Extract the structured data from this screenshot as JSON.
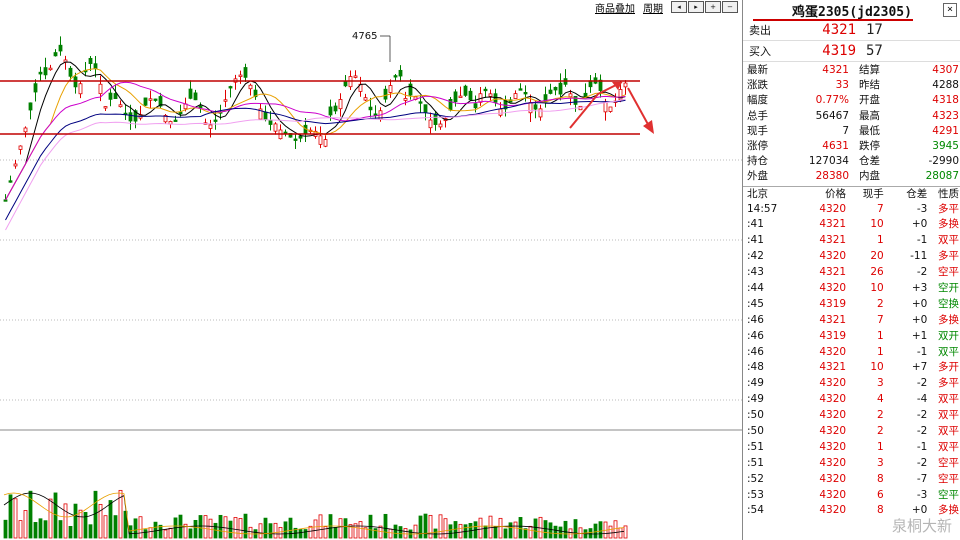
{
  "toolbar": {
    "overlay_label": "商品叠加",
    "period_label": "周期",
    "btn_icons": [
      "left-arrow-icon",
      "right-arrow-icon",
      "zoom-in-icon",
      "zoom-out-icon"
    ]
  },
  "chart_data": {
    "type": "candlestick",
    "high_marker": "4765",
    "colors": {
      "up": "#e00000",
      "down": "#008000",
      "levels": "#c00000",
      "arrow": "#e03030"
    },
    "moving_average_colors": [
      "#000000",
      "#e8a000",
      "#cc00cc",
      "#000080",
      "#b050b0",
      "#f0a0f0"
    ]
  },
  "instrument": {
    "title": "鸡蛋2305(jd2305)"
  },
  "orderbook": {
    "ask": {
      "label": "卖出",
      "price": "4321",
      "volume": "17"
    },
    "bid": {
      "label": "买入",
      "price": "4319",
      "volume": "57"
    }
  },
  "quote": [
    {
      "k1": "最新",
      "v1": "4321",
      "c1": "red",
      "k2": "结算",
      "v2": "4307",
      "c2": "red"
    },
    {
      "k1": "涨跌",
      "v1": "33",
      "c1": "red",
      "k2": "昨结",
      "v2": "4288",
      "c2": "dark"
    },
    {
      "k1": "幅度",
      "v1": "0.77%",
      "c1": "red",
      "k2": "开盘",
      "v2": "4318",
      "c2": "red"
    },
    {
      "k1": "总手",
      "v1": "56467",
      "c1": "dark",
      "k2": "最高",
      "v2": "4323",
      "c2": "red"
    },
    {
      "k1": "现手",
      "v1": "7",
      "c1": "dark",
      "k2": "最低",
      "v2": "4291",
      "c2": "red"
    },
    {
      "k1": "涨停",
      "v1": "4631",
      "c1": "red",
      "k2": "跌停",
      "v2": "3945",
      "c2": "green"
    },
    {
      "k1": "持仓",
      "v1": "127034",
      "c1": "dark",
      "k2": "仓差",
      "v2": "-2990",
      "c2": "dark"
    },
    {
      "k1": "外盘",
      "v1": "28380",
      "c1": "red",
      "k2": "内盘",
      "v2": "28087",
      "c2": "green"
    }
  ],
  "ticks_header": {
    "time": "北京",
    "price": "价格",
    "vol": "现手",
    "oi": "仓差",
    "nature": "性质"
  },
  "ticks": [
    {
      "time": "14:57",
      "price": "4320",
      "vol": "7",
      "oi": "-3",
      "nature": "多平",
      "nc": "red"
    },
    {
      "time": ":41",
      "price": "4321",
      "vol": "10",
      "oi": "+0",
      "nature": "多换",
      "nc": "red"
    },
    {
      "time": ":41",
      "price": "4321",
      "vol": "1",
      "oi": "-1",
      "nature": "双平",
      "nc": "red"
    },
    {
      "time": ":42",
      "price": "4320",
      "vol": "20",
      "oi": "-11",
      "nature": "多平",
      "nc": "red"
    },
    {
      "time": ":43",
      "price": "4321",
      "vol": "26",
      "oi": "-2",
      "nature": "空平",
      "nc": "red"
    },
    {
      "time": ":44",
      "price": "4320",
      "vol": "10",
      "oi": "+3",
      "nature": "空开",
      "nc": "green"
    },
    {
      "time": ":45",
      "price": "4319",
      "vol": "2",
      "oi": "+0",
      "nature": "空换",
      "nc": "green"
    },
    {
      "time": ":46",
      "price": "4321",
      "vol": "7",
      "oi": "+0",
      "nature": "多换",
      "nc": "red"
    },
    {
      "time": ":46",
      "price": "4319",
      "vol": "1",
      "oi": "+1",
      "nature": "双开",
      "nc": "green"
    },
    {
      "time": ":46",
      "price": "4320",
      "vol": "1",
      "oi": "-1",
      "nature": "双平",
      "nc": "green"
    },
    {
      "time": ":48",
      "price": "4321",
      "vol": "10",
      "oi": "+7",
      "nature": "多开",
      "nc": "red"
    },
    {
      "time": ":49",
      "price": "4320",
      "vol": "3",
      "oi": "-2",
      "nature": "多平",
      "nc": "red"
    },
    {
      "time": ":49",
      "price": "4320",
      "vol": "4",
      "oi": "-4",
      "nature": "双平",
      "nc": "red"
    },
    {
      "time": ":50",
      "price": "4320",
      "vol": "2",
      "oi": "-2",
      "nature": "双平",
      "nc": "red"
    },
    {
      "time": ":50",
      "price": "4320",
      "vol": "2",
      "oi": "-2",
      "nature": "双平",
      "nc": "red"
    },
    {
      "time": ":51",
      "price": "4320",
      "vol": "1",
      "oi": "-1",
      "nature": "双平",
      "nc": "red"
    },
    {
      "time": ":51",
      "price": "4320",
      "vol": "3",
      "oi": "-2",
      "nature": "空平",
      "nc": "red"
    },
    {
      "time": ":52",
      "price": "4320",
      "vol": "8",
      "oi": "-7",
      "nature": "空平",
      "nc": "red"
    },
    {
      "time": ":53",
      "price": "4320",
      "vol": "6",
      "oi": "-3",
      "nature": "空平",
      "nc": "green"
    },
    {
      "time": ":54",
      "price": "4320",
      "vol": "8",
      "oi": "+0",
      "nature": "多换",
      "nc": "red"
    }
  ],
  "watermark": "泉桐大新"
}
